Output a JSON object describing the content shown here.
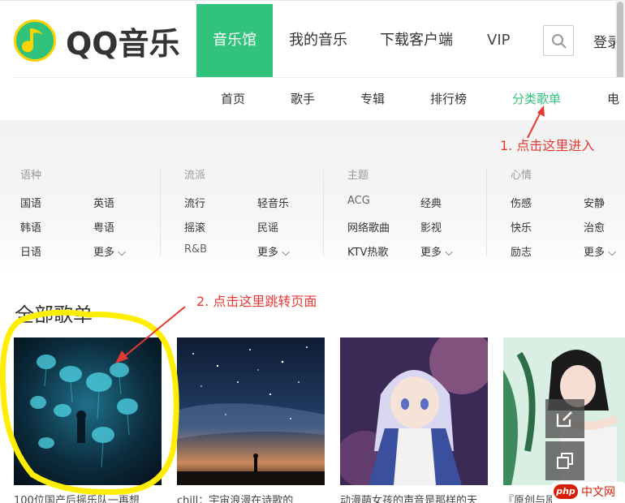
{
  "header": {
    "logo_text": "QQ音乐",
    "nav": [
      "音乐馆",
      "我的音乐",
      "下载客户端",
      "VIP"
    ],
    "active_nav": "音乐馆",
    "login_label": "登录"
  },
  "subnav": {
    "items": [
      "首页",
      "歌手",
      "专辑",
      "排行榜",
      "分类歌单",
      "电"
    ],
    "active": "分类歌单"
  },
  "annotations": {
    "step1": "1. 点击这里进入",
    "step2": "2. 点击这里跳转页面"
  },
  "categories": [
    {
      "title": "语种",
      "options": [
        "国语",
        "英语",
        "韩语",
        "粤语",
        "日语",
        "更多"
      ]
    },
    {
      "title": "流派",
      "options": [
        "流行",
        "轻音乐",
        "摇滚",
        "民谣",
        "R&B",
        "更多"
      ]
    },
    {
      "title": "主题",
      "options": [
        "ACG",
        "经典",
        "网络歌曲",
        "影视",
        "KTV热歌",
        "更多"
      ]
    },
    {
      "title": "心情",
      "options": [
        "伤感",
        "安静",
        "快乐",
        "治愈",
        "励志",
        "更多"
      ]
    }
  ],
  "section": {
    "title": "全部歌单"
  },
  "playlists": [
    {
      "title": "100位国产后摇乐队一再想"
    },
    {
      "title": "chill：宇宙浪漫在诗歌的"
    },
    {
      "title": "动漫萌女孩的声音是那样的天"
    },
    {
      "title": "『原创与原唱』古风音乐"
    }
  ],
  "watermark": {
    "badge": "php",
    "text": "中文网"
  },
  "colors": {
    "brand_green": "#31c27c",
    "annotation_red": "#e53935",
    "highlight_yellow": "#ffee00"
  }
}
